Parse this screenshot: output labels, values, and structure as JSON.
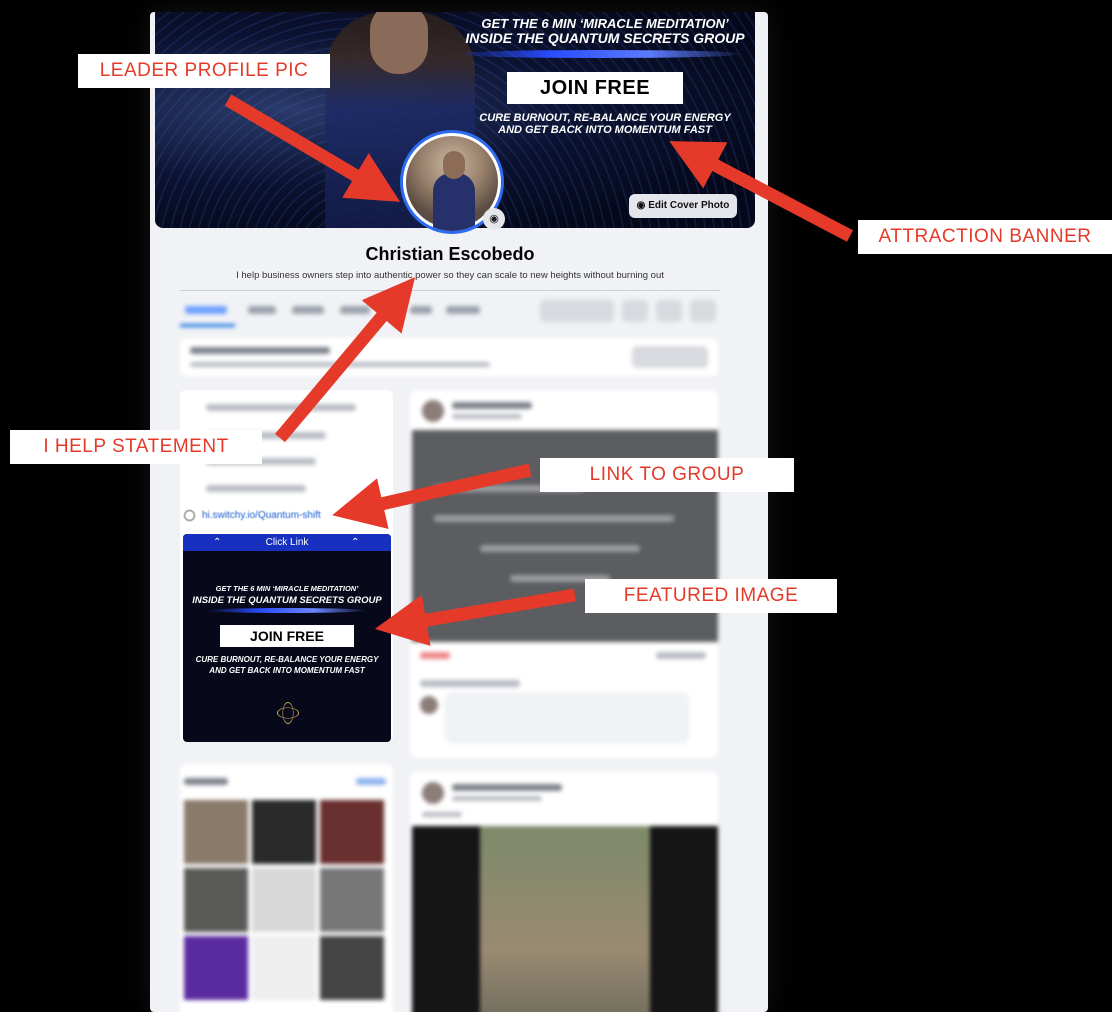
{
  "profile": {
    "name": "Christian Escobedo",
    "bio": "I help business owners step into authentic power so they can scale to new heights without burning out",
    "group_link": "hi.switchy.io/Quantum-shift"
  },
  "cover_banner": {
    "line1": "GET THE 6 MIN ‘MIRACLE MEDITATION’",
    "line2": "INSIDE THE QUANTUM SECRETS GROUP",
    "cta": "JOIN FREE",
    "sub1": "CURE BURNOUT, RE-BALANCE YOUR ENERGY",
    "sub2": "AND GET BACK INTO MOMENTUM FAST",
    "edit_cover_label": "Edit Cover Photo"
  },
  "featured_image": {
    "header": "Click Link",
    "line1": "GET THE 6 MIN ‘MIRACLE MEDITATION’",
    "line2": "INSIDE THE QUANTUM SECRETS GROUP",
    "cta": "JOIN FREE",
    "sub1": "CURE BURNOUT, RE-BALANCE YOUR ENERGY",
    "sub2": "AND GET BACK INTO MOMENTUM FAST"
  },
  "annotations": {
    "leader_profile_pic": "LEADER PROFILE PIC",
    "attraction_banner": "ATTRACTION BANNER",
    "i_help_statement": "I HELP STATEMENT",
    "link_to_group": "LINK TO GROUP",
    "featured_image": "FEATURED IMAGE"
  },
  "colors": {
    "annotation_red": "#e53a2a",
    "facebook_blue": "#1b74e4",
    "banner_blue": "#1730c0"
  }
}
